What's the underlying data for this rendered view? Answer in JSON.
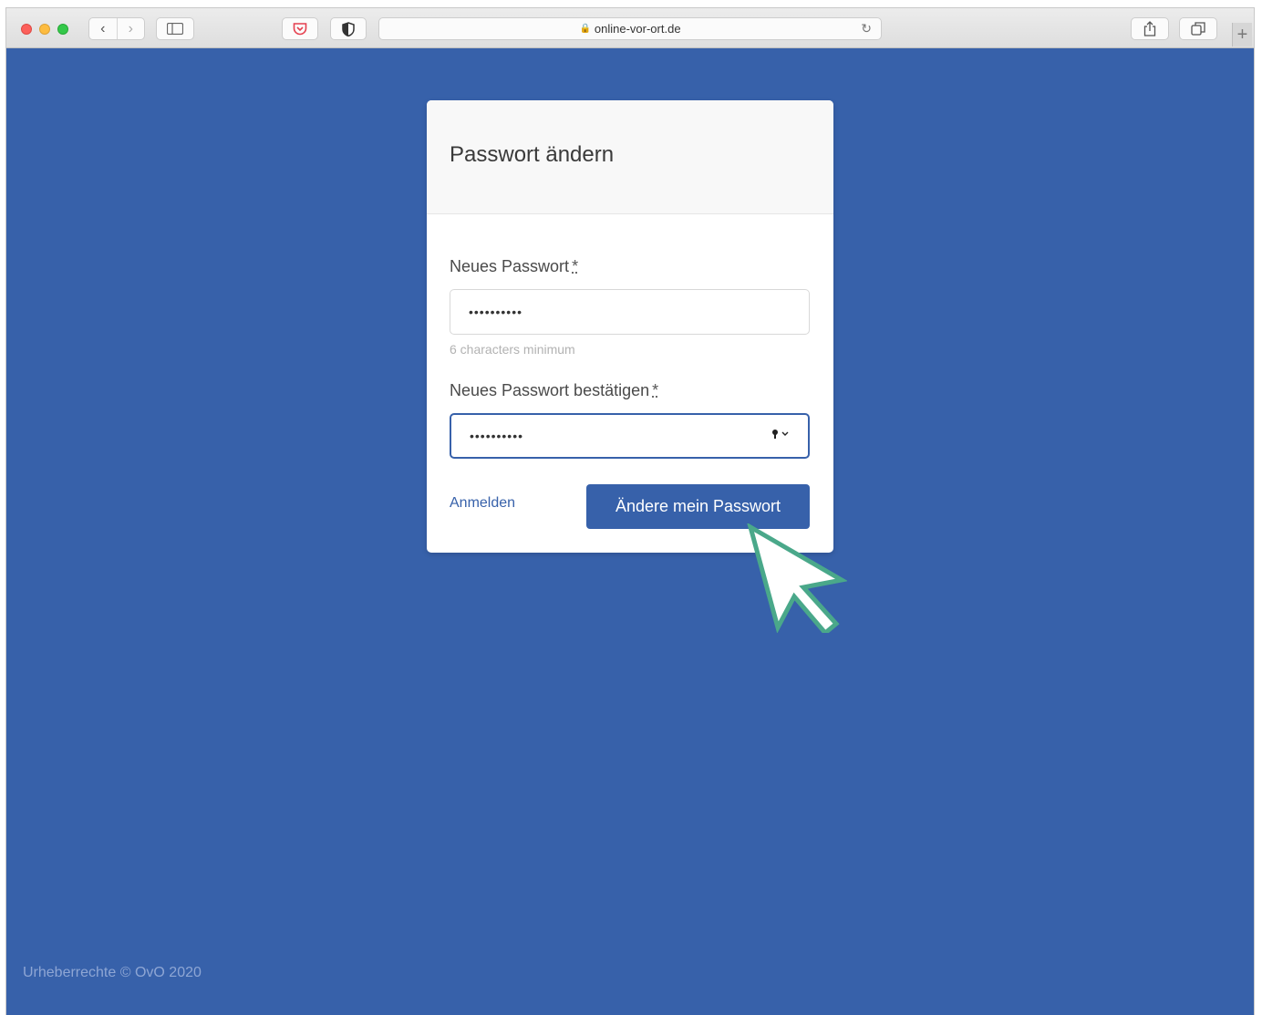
{
  "browser": {
    "url": "online-vor-ort.de",
    "back_icon": "‹",
    "forward_icon": "›",
    "new_tab": "+"
  },
  "form": {
    "title": "Passwort ändern",
    "new_password_label": "Neues Passwort",
    "new_password_value": "••••••••••",
    "new_password_hint": "6 characters minimum",
    "confirm_password_label": "Neues Passwort bestätigen",
    "confirm_password_value": "••••••••••",
    "required_mark": "*",
    "login_link": "Anmelden",
    "submit_label": "Ändere mein Passwort"
  },
  "footer": {
    "copyright": "Urheberrechte © OvO 2020"
  },
  "colors": {
    "page_background": "#3761aa",
    "button": "#3761aa",
    "cursor_outline": "#4aa88a"
  }
}
